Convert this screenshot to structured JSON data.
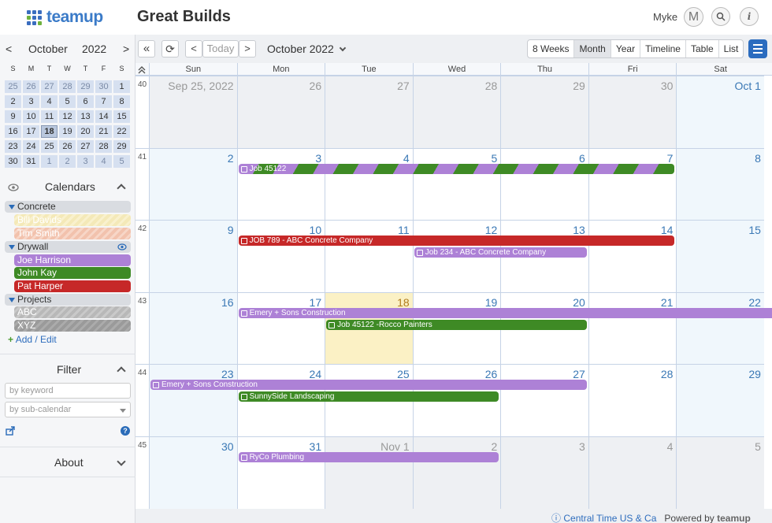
{
  "brand": {
    "logo_text": "teamup",
    "title": "Great Builds"
  },
  "user": {
    "name": "Myke",
    "avatar_initial": "M",
    "info": "i"
  },
  "mini": {
    "month": "October",
    "year": "2022",
    "prev": "<",
    "next": ">",
    "dows": [
      "S",
      "M",
      "T",
      "W",
      "T",
      "F",
      "S"
    ],
    "rows": [
      [
        "25",
        "26",
        "27",
        "28",
        "29",
        "30",
        "1"
      ],
      [
        "2",
        "3",
        "4",
        "5",
        "6",
        "7",
        "8"
      ],
      [
        "9",
        "10",
        "11",
        "12",
        "13",
        "14",
        "15"
      ],
      [
        "16",
        "17",
        "18",
        "19",
        "20",
        "21",
        "22"
      ],
      [
        "23",
        "24",
        "25",
        "26",
        "27",
        "28",
        "29"
      ],
      [
        "30",
        "31",
        "1",
        "2",
        "3",
        "4",
        "5"
      ]
    ]
  },
  "calendars": {
    "title": "Calendars",
    "groups": [
      "Concrete",
      "Drywall",
      "Projects"
    ],
    "items": [
      {
        "label": "Bill Davids",
        "color": "#f4e9b8"
      },
      {
        "label": "Tim Smith",
        "color": "#f2c2ad"
      },
      {
        "label": "Joe Harrison",
        "color": "#ad81d6"
      },
      {
        "label": "John Kay",
        "color": "#3e8a25"
      },
      {
        "label": "Pat Harper",
        "color": "#c62828"
      },
      {
        "label": "ABC",
        "color": "#b8b8b8"
      },
      {
        "label": "XYZ",
        "color": "#9a9a9a"
      }
    ],
    "add_edit": "Add / Edit"
  },
  "filter": {
    "title": "Filter",
    "keyword_placeholder": "by keyword",
    "subcal_placeholder": "by sub-calendar"
  },
  "about": {
    "title": "About"
  },
  "toolbar": {
    "prev_all": "«",
    "refresh": "⟳",
    "prev": "<",
    "today": "Today",
    "next": ">",
    "current": "October 2022",
    "views": [
      "8 Weeks",
      "Month",
      "Year",
      "Timeline",
      "Table",
      "List"
    ],
    "active_view": "Month"
  },
  "grid": {
    "dows": [
      "Sun",
      "Mon",
      "Tue",
      "Wed",
      "Thu",
      "Fri",
      "Sat"
    ],
    "weeks": [
      {
        "num": "40",
        "days": [
          "Sep 25, 2022",
          "26",
          "27",
          "28",
          "29",
          "30",
          "Oct 1"
        ]
      },
      {
        "num": "41",
        "days": [
          "2",
          "3",
          "4",
          "5",
          "6",
          "7",
          "8"
        ]
      },
      {
        "num": "42",
        "days": [
          "9",
          "10",
          "11",
          "12",
          "13",
          "14",
          "15"
        ]
      },
      {
        "num": "43",
        "days": [
          "16",
          "17",
          "18",
          "19",
          "20",
          "21",
          "22"
        ]
      },
      {
        "num": "44",
        "days": [
          "23",
          "24",
          "25",
          "26",
          "27",
          "28",
          "29"
        ]
      },
      {
        "num": "45",
        "days": [
          "30",
          "31",
          "Nov 1",
          "2",
          "3",
          "4",
          "5"
        ]
      }
    ]
  },
  "events": [
    {
      "title": "Job 45122",
      "color": "stripe",
      "week": 1,
      "start": 1,
      "end": 5,
      "row": 0
    },
    {
      "title": "JOB 789 - ABC Concrete Company",
      "color": "red",
      "week": 2,
      "start": 1,
      "end": 5,
      "row": 0
    },
    {
      "title": "Job 234 - ABC Concrete Company",
      "color": "purple",
      "week": 2,
      "start": 3,
      "end": 4,
      "row": 1
    },
    {
      "title": "Emery + Sons Construction",
      "color": "purple",
      "week": 3,
      "start": 1,
      "end": 6,
      "row": 0
    },
    {
      "title": "Job 45122 -Rocco Painters",
      "color": "green",
      "week": 3,
      "start": 2,
      "end": 4,
      "row": 1
    },
    {
      "title": "Emery + Sons Construction",
      "color": "purple",
      "week": 4,
      "start": 0,
      "end": 4,
      "row": 0
    },
    {
      "title": "SunnySide Landscaping",
      "color": "green",
      "week": 4,
      "start": 1,
      "end": 3,
      "row": 1
    },
    {
      "title": "RyCo Plumbing",
      "color": "purple",
      "week": 5,
      "start": 1,
      "end": 3,
      "row": 0
    }
  ],
  "footer": {
    "timezone": "Central Time US & Ca",
    "powered": "Powered by",
    "brand": "teamup"
  }
}
